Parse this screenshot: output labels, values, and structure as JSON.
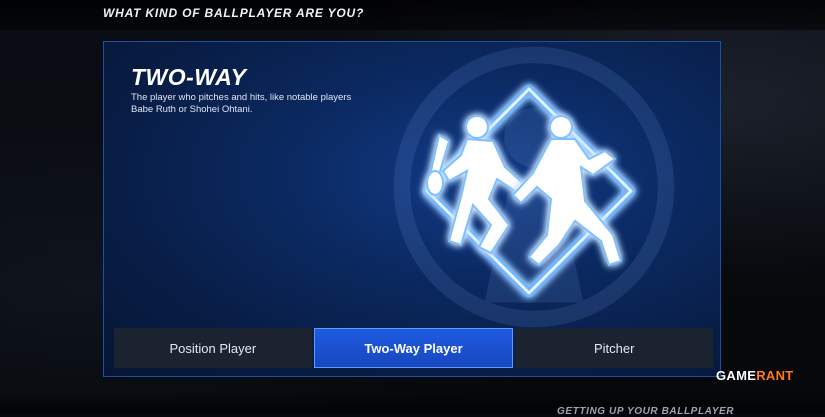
{
  "header": {
    "title": "WHAT KIND OF BALLPLAYER ARE YOU?"
  },
  "card": {
    "title": "TWO-WAY",
    "description": "The player who pitches and hits, like notable players Babe Ruth or Shohei Ohtani.",
    "emblem_icon": "two-way-player-emblem-icon",
    "accent_color": "#5aa8ff"
  },
  "tabs": [
    {
      "label": "Position Player",
      "selected": false
    },
    {
      "label": "Two-Way Player",
      "selected": true
    },
    {
      "label": "Pitcher",
      "selected": false
    }
  ],
  "watermark": {
    "brand_first": "GAME",
    "brand_second": "RANT"
  },
  "footer": {
    "text": "GETTING UP YOUR BALLPLAYER"
  }
}
